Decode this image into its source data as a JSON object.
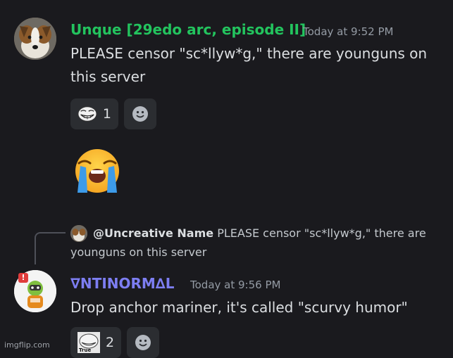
{
  "messages": [
    {
      "username": "Unque [29edo arc, episode II]",
      "username_color": "#23c45e",
      "timestamp": "Today at 9:52 PM",
      "text": "PLEASE censor \"sc*llyw*g,\" there are younguns on this server",
      "avatar_icon": "dog-avatar",
      "reactions": [
        {
          "emoji": "trollface-emoji",
          "count": "1"
        }
      ]
    },
    {
      "emoji": "😭"
    },
    {
      "reply": {
        "username": "@Uncreative Name",
        "text": "PLEASE censor \"sc*llyw*g,\" there are younguns on this server"
      },
      "username": "∇NTINORM∆L",
      "username_color": "#7d7ef2",
      "timestamp": "Today at 9:56 PM",
      "text": "Drop anchor mariner, it's called \"scurvy humor\"",
      "avatar_icon": "kerbal-avatar",
      "reactions": [
        {
          "emoji": "true-trollface-emoji",
          "label": "True",
          "count": "2"
        }
      ]
    }
  ],
  "watermark": "imgflip.com"
}
